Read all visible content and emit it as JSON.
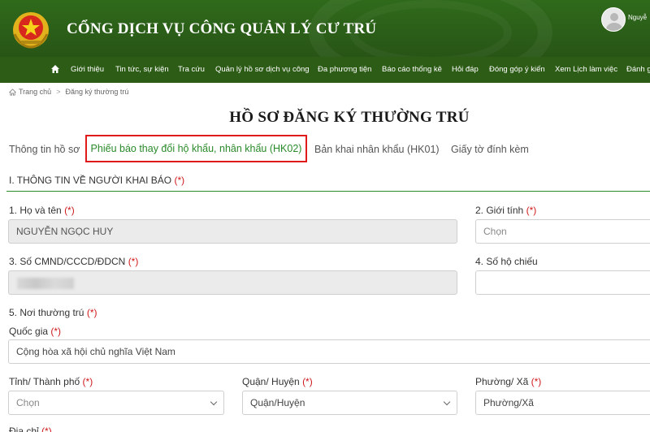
{
  "header": {
    "site_title": "CỔNG DỊCH VỤ CÔNG QUẢN LÝ CƯ TRÚ",
    "user_name": "Nguyễ"
  },
  "nav": {
    "items": [
      "Giới thiệu",
      "Tin tức, sự kiện",
      "Tra cứu",
      "Quản lý hồ sơ dịch vụ công",
      "Đa phương tiện",
      "Báo cáo thống kê",
      "Hỏi đáp",
      "Đóng góp ý kiến",
      "Xem Lịch làm việc",
      "Đánh g"
    ]
  },
  "breadcrumb": {
    "home": "Trang chủ",
    "current": "Đăng ký thường trú"
  },
  "page_title": "HỒ SƠ ĐĂNG KÝ THƯỜNG TRÚ",
  "tabs": [
    {
      "label": "Thông tin hồ sơ",
      "active": false
    },
    {
      "label": "Phiếu báo thay đổi hộ khẩu, nhân khẩu (HK02)",
      "active": true
    },
    {
      "label": "Bản khai nhân khẩu (HK01)",
      "active": false
    },
    {
      "label": "Giấy tờ đính kèm",
      "active": false
    }
  ],
  "section": {
    "title": "I. THÔNG TIN VỀ NGƯỜI KHAI BÁO",
    "required_mark": "(*)"
  },
  "form": {
    "full_name": {
      "label": "1. Họ và tên",
      "req": "(*)",
      "value": "NGUYỄN NGỌC HUY"
    },
    "gender": {
      "label": "2. Giới tính",
      "req": "(*)",
      "placeholder": "Chọn"
    },
    "id_number": {
      "label": "3. Số CMND/CCCD/ĐDCN",
      "req": "(*)"
    },
    "passport": {
      "label": "4. Số hộ chiếu"
    },
    "residence": {
      "label": "5. Nơi thường trú",
      "req": "(*)"
    },
    "country": {
      "label": "Quốc gia",
      "req": "(*)",
      "value": "Cộng hòa xã hội chủ nghĩa Việt Nam"
    },
    "province": {
      "label": "Tỉnh/ Thành phố",
      "req": "(*)",
      "placeholder": "Chọn"
    },
    "district": {
      "label": "Quận/ Huyện",
      "req": "(*)",
      "placeholder": "Quận/Huyện"
    },
    "ward": {
      "label": "Phường/ Xã",
      "req": "(*)",
      "placeholder": "Phường/Xã"
    },
    "address": {
      "label": "Địa chỉ",
      "req": "(*)"
    }
  },
  "colors": {
    "header_green": "#2c5e1a",
    "accent_green": "#2a8a2a",
    "required_red": "#d0191b",
    "highlight_border": "#e0191b"
  }
}
